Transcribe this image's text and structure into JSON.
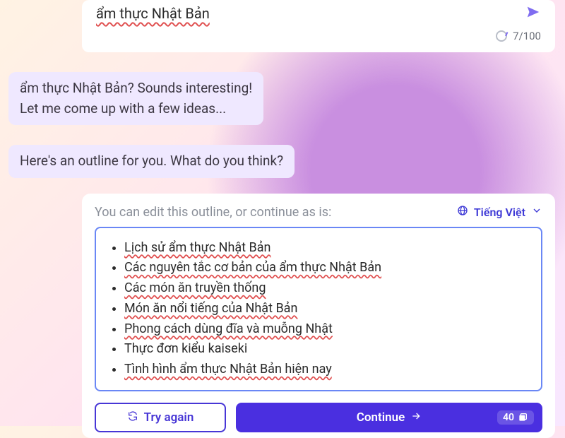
{
  "input": {
    "value": "ẩm thực Nhật Bản",
    "counter": "7/100"
  },
  "bubble1_line1": "ẩm thực Nhật Bản? Sounds interesting!",
  "bubble1_line2": "Let me come up with a few ideas...",
  "bubble2": "Here's an outline for you. What do you think?",
  "result": {
    "hint": "You can edit this outline, or continue as is:",
    "language": "Tiếng Việt",
    "outline": [
      "Lịch sử ẩm thực Nhật Bản",
      "Các nguyên tắc cơ bản của ẩm thực Nhật Bản",
      "Các món ăn truyền thống",
      "Món ăn nổi tiếng của Nhật Bản",
      "Phong cách dùng đĩa và muỗng Nhật",
      "Thực đơn kiểu kaiseki",
      "Tình hình ẩm thực Nhật Bản hiện nay"
    ]
  },
  "buttons": {
    "tryagain": "Try again",
    "continue": "Continue",
    "credits": "40"
  }
}
